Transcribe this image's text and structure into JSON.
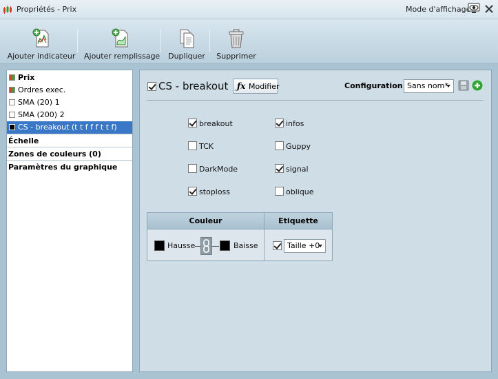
{
  "window": {
    "title": "Propriétés - Prix",
    "mode_label": "Mode d'affichage"
  },
  "toolbar": {
    "add_indicator": "Ajouter indicateur",
    "add_fill": "Ajouter remplissage",
    "duplicate": "Dupliquer",
    "delete": "Supprimer"
  },
  "tree": {
    "items": [
      {
        "label": "Prix",
        "swatch": "red-green"
      },
      {
        "label": "Ordres exec.",
        "swatch": "red-green"
      },
      {
        "label": "SMA (20) 1",
        "swatch": "white"
      },
      {
        "label": "SMA (200) 2",
        "swatch": "white"
      },
      {
        "label": "CS - breakout (t t f f f t t f)",
        "swatch": "black",
        "selected": true
      }
    ],
    "sections": [
      "Échelle",
      "Zones de couleurs (0)",
      "Paramètres du graphique"
    ]
  },
  "indicator": {
    "name": "CS - breakout",
    "enabled": true,
    "modify_label": "Modifier",
    "config_label": "Configuration :",
    "config_value": "Sans nom*"
  },
  "options": [
    {
      "label": "breakout",
      "checked": true
    },
    {
      "label": "infos",
      "checked": true
    },
    {
      "label": "TCK",
      "checked": false
    },
    {
      "label": "Guppy",
      "checked": false
    },
    {
      "label": "DarkMode",
      "checked": false
    },
    {
      "label": "signal",
      "checked": true
    },
    {
      "label": "stoploss",
      "checked": true
    },
    {
      "label": "oblique",
      "checked": false
    }
  ],
  "color_table": {
    "col_color": "Couleur",
    "col_label": "Etiquette",
    "up_label": "Hausse",
    "down_label": "Baisse",
    "up_color": "#000000",
    "down_color": "#000000",
    "label_enabled": true,
    "size_value": "Taille +0"
  },
  "colors": {
    "selection": "#3a78c7",
    "panel_bg": "#cfdde7",
    "accent_green": "#2fa52f"
  }
}
